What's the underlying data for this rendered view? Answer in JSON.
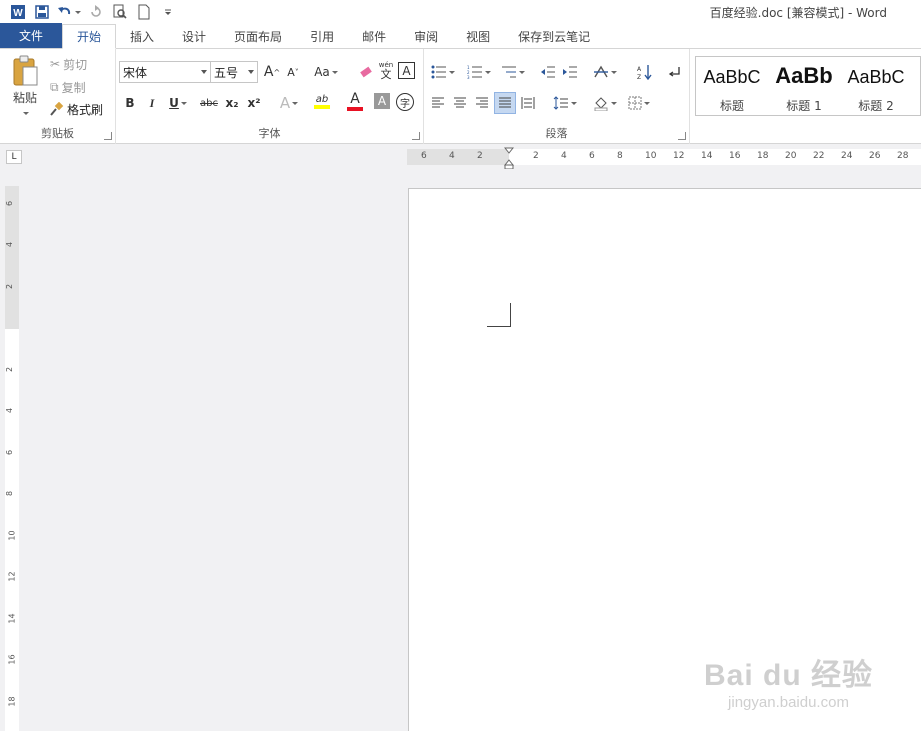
{
  "window": {
    "title": "百度经验.doc [兼容模式] - Word"
  },
  "qat": {
    "icons": [
      "word-logo-icon",
      "save-icon",
      "undo-icon",
      "redo-icon",
      "print-preview-icon",
      "new-document-icon",
      "customize-qat-icon"
    ]
  },
  "tabs": {
    "file": "文件",
    "home": "开始",
    "insert": "插入",
    "design": "设计",
    "layout": "页面布局",
    "references": "引用",
    "mailings": "邮件",
    "review": "审阅",
    "view": "视图",
    "evernote": "保存到云笔记"
  },
  "clipboard": {
    "paste": "粘贴",
    "cut": "剪切",
    "copy": "复制",
    "format_painter": "格式刷",
    "group": "剪贴板"
  },
  "font": {
    "name": "宋体",
    "size": "五号",
    "case_label": "Aa",
    "bold": "B",
    "italic": "I",
    "underline": "U",
    "strike": "abc",
    "subscript": "x₂",
    "superscript": "x²",
    "effects": "A",
    "highlight": "ab",
    "color": "A",
    "shading": "A",
    "enclose": "字",
    "grow": "A",
    "shrink": "A",
    "clear": "A",
    "phonetic": "wén",
    "phonetic_char": "文",
    "border": "A",
    "group": "字体"
  },
  "paragraph": {
    "group": "段落"
  },
  "styles": {
    "items": [
      {
        "sample": "AaBbC",
        "name": "标题"
      },
      {
        "sample": "AaBb",
        "name": "标题 1"
      },
      {
        "sample": "AaBbC",
        "name": "标题 2"
      }
    ]
  },
  "ruler": {
    "h_labels": [
      "6",
      "4",
      "2",
      "2",
      "4",
      "6",
      "8",
      "10",
      "12",
      "14",
      "16",
      "18",
      "20",
      "22",
      "24",
      "26",
      "28"
    ],
    "v_labels": [
      "6",
      "4",
      "2",
      "2",
      "4",
      "6",
      "8",
      "10",
      "12",
      "14",
      "16",
      "18"
    ],
    "tab_selector": "L"
  },
  "watermark": {
    "brand": "Bai du 经验",
    "url": "jingyan.baidu.com"
  },
  "colors": {
    "accent": "#2b579a",
    "highlight_yellow": "#ffff00",
    "font_red": "#e81123"
  }
}
